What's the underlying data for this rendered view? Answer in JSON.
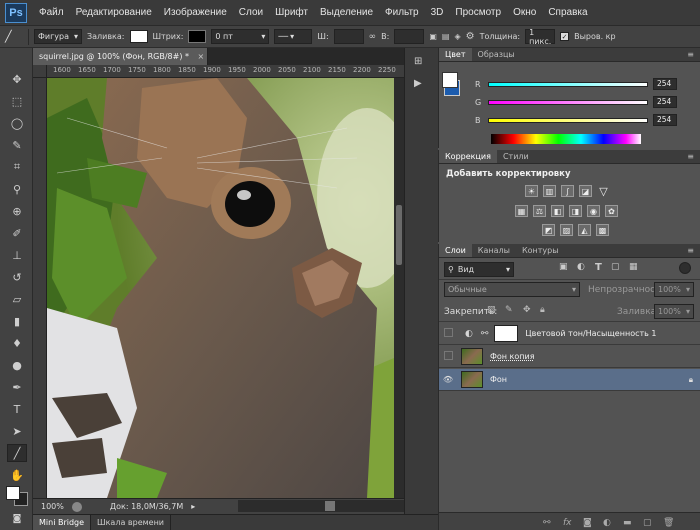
{
  "app": {
    "logo": "Ps"
  },
  "menu": [
    "Файл",
    "Редактирование",
    "Изображение",
    "Слои",
    "Шрифт",
    "Выделение",
    "Фильтр",
    "3D",
    "Просмотр",
    "Окно",
    "Справка"
  ],
  "options": {
    "shape": "Фигура",
    "fill_label": "Заливка:",
    "stroke_label": "Штрих:",
    "stroke_width": "0 пт",
    "w_label": "Ш:",
    "h_label": "В:",
    "thickness_label": "Толщина:",
    "thickness_value": "1 пикс.",
    "align_label": "Выров. кр"
  },
  "document": {
    "tab_title": "squirrel.jpg @ 100% (Фон, RGB/8#) *",
    "ruler_ticks": [
      "1600",
      "1650",
      "1700",
      "1750",
      "1800",
      "1850",
      "1900",
      "1950",
      "2000",
      "2050",
      "2100",
      "2150",
      "2200",
      "2250"
    ],
    "zoom": "100%",
    "doc_size": "Док: 18,0M/36,7M"
  },
  "bottom_tabs": [
    "Mini Bridge",
    "Шкала времени"
  ],
  "color_panel": {
    "tabs": [
      "Цвет",
      "Образцы"
    ],
    "r_label": "R",
    "g_label": "G",
    "b_label": "B",
    "r": "254",
    "g": "254",
    "b": "254"
  },
  "adjust_panel": {
    "tabs": [
      "Коррекция",
      "Стили"
    ],
    "heading": "Добавить корректировку"
  },
  "layers_panel": {
    "tabs": [
      "Слои",
      "Каналы",
      "Контуры"
    ],
    "filter_kind": "Вид",
    "blend_mode": "Обычные",
    "opacity_label": "Непрозрачность:",
    "opacity": "100%",
    "lock_label": "Закрепить:",
    "fill_label": "Заливка:",
    "fill": "100%",
    "layers": [
      {
        "name": "Цветовой тон/Насыщенность 1"
      },
      {
        "name": "Фон копия"
      },
      {
        "name": "Фон"
      }
    ]
  },
  "colors": {
    "accent": "#4a8fd0",
    "selected_layer": "#5a6e8a"
  }
}
